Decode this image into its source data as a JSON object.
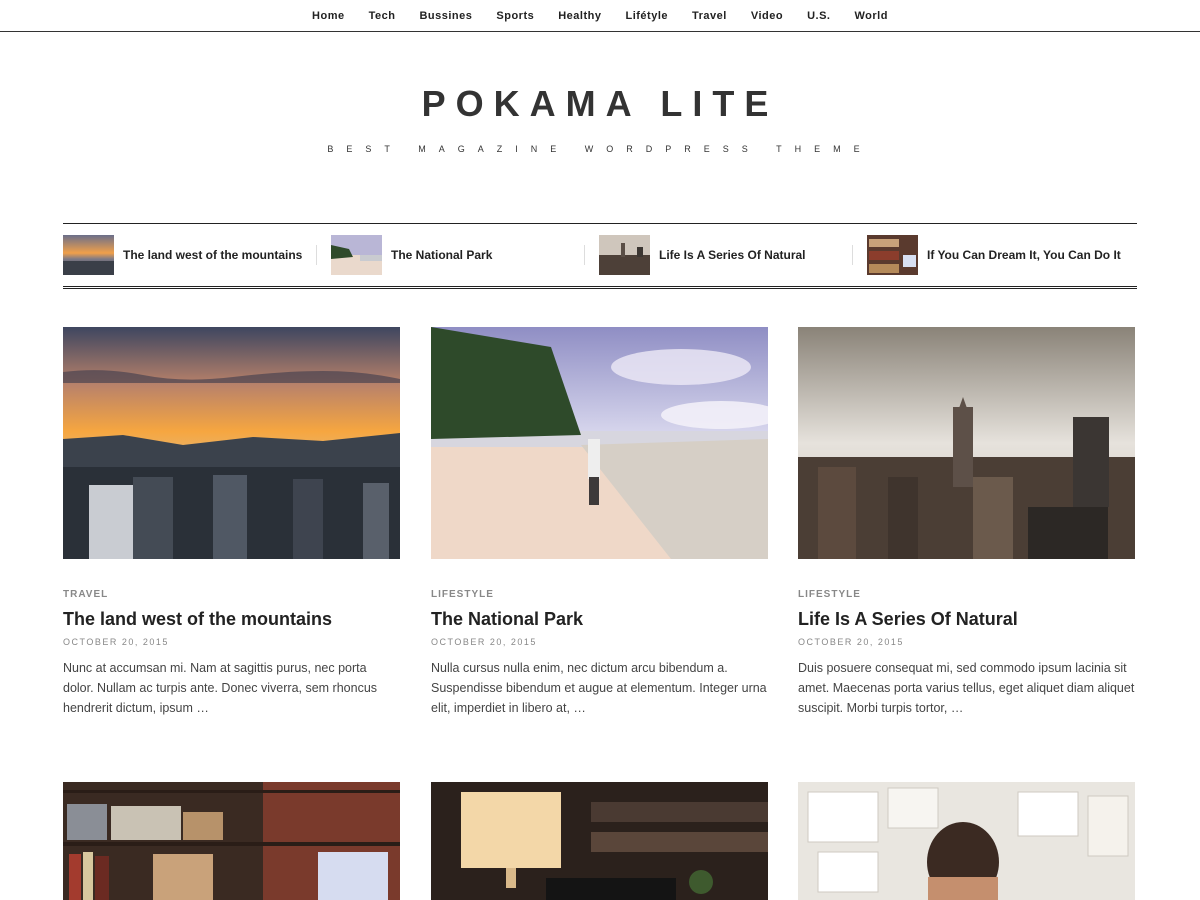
{
  "nav": {
    "items": [
      "Home",
      "Tech",
      "Bussines",
      "Sports",
      "Healthy",
      "Lifétyle",
      "Travel",
      "Video",
      "U.S.",
      "World"
    ]
  },
  "site": {
    "title": "POKAMA LITE",
    "tagline": "BEST MAGAZINE WORDPRESS THEME"
  },
  "featured": [
    {
      "title": "The land west of the mountains"
    },
    {
      "title": "The National Park"
    },
    {
      "title": "Life Is A Series Of Natural"
    },
    {
      "title": "If You Can Dream It, You Can Do It"
    }
  ],
  "posts": [
    {
      "category": "TRAVEL",
      "title": "The land west of the mountains",
      "date": "OCTOBER 20, 2015",
      "excerpt": "Nunc at accumsan mi. Nam at sagittis purus, nec porta dolor. Nullam ac turpis ante. Donec viverra, sem rhoncus hendrerit dictum, ipsum …"
    },
    {
      "category": "LIFESTYLE",
      "title": "The National Park",
      "date": "OCTOBER 20, 2015",
      "excerpt": "Nulla cursus nulla enim, nec dictum arcu bibendum a. Suspendisse bibendum et augue at elementum. Integer urna elit, imperdiet in libero at, …"
    },
    {
      "category": "LIFESTYLE",
      "title": "Life Is A Series Of Natural",
      "date": "OCTOBER 20, 2015",
      "excerpt": "Duis posuere consequat mi, sed commodo ipsum lacinia sit amet. Maecenas porta varius tellus, eget aliquet diam aliquet suscipit. Morbi turpis tortor, …"
    }
  ],
  "colors": {
    "text": "#222222",
    "muted": "#888888",
    "divider": "#333333"
  }
}
